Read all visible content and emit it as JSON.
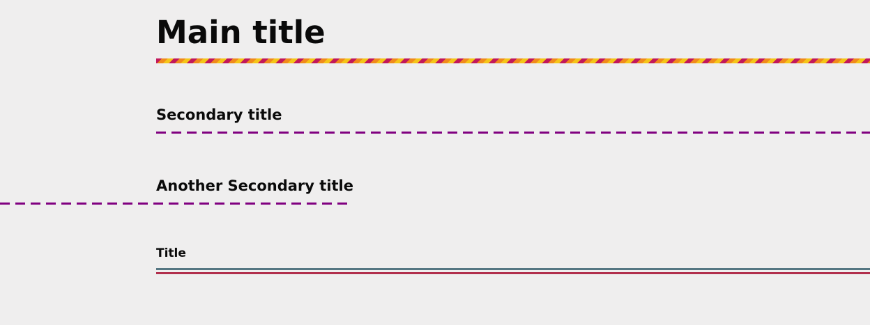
{
  "headings": {
    "main_title": "Main title",
    "secondary_title": "Secondary title",
    "another_secondary_title": "Another Secondary title",
    "title": "Title"
  },
  "colors": {
    "background": "#efeeee",
    "text": "#0a0a0a",
    "stripe_magenta": "#c2185b",
    "stripe_orange": "#f08a1c",
    "stripe_yellow": "#f5c518",
    "dashed_purple": "#800080",
    "rule_slate": "#557682",
    "rule_crimson": "#b12f4c"
  }
}
